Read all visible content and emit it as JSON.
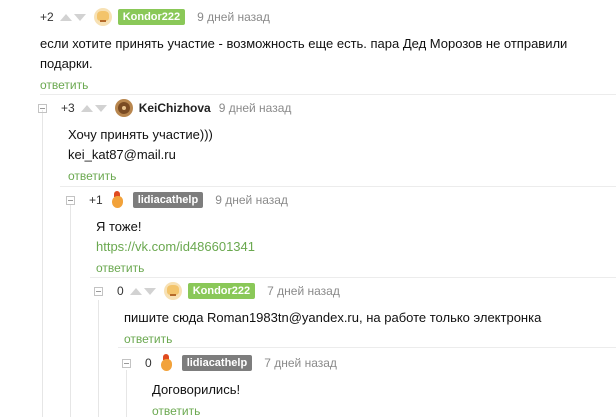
{
  "comments": [
    {
      "rating": "+2",
      "username": "Kondor222",
      "date": "9 дней назад",
      "lines": [
        "если хотите принять участие - возможность еще есть. пара Дед Морозов не отправили",
        "подарки."
      ],
      "reply": "ответить"
    },
    {
      "rating": "+3",
      "username": "KeiChizhova",
      "date": "9 дней назад",
      "lines": [
        "Хочу принять участие)))",
        "kei_kat87@mail.ru"
      ],
      "reply": "ответить"
    },
    {
      "rating": "+1",
      "username": "lidiacathelp",
      "date": "9 дней назад",
      "lines": [
        "Я тоже!"
      ],
      "link": "https://vk.com/id486601341",
      "reply": "ответить"
    },
    {
      "rating": "0",
      "username": "Kondor222",
      "date": "7 дней назад",
      "lines": [
        "пишите сюда Roman1983tn@yandex.ru, на работе только электронка"
      ],
      "reply": "ответить"
    },
    {
      "rating": "0",
      "username": "lidiacathelp",
      "date": "7 дней назад",
      "lines": [
        "Договорились!"
      ],
      "reply": "ответить"
    }
  ]
}
